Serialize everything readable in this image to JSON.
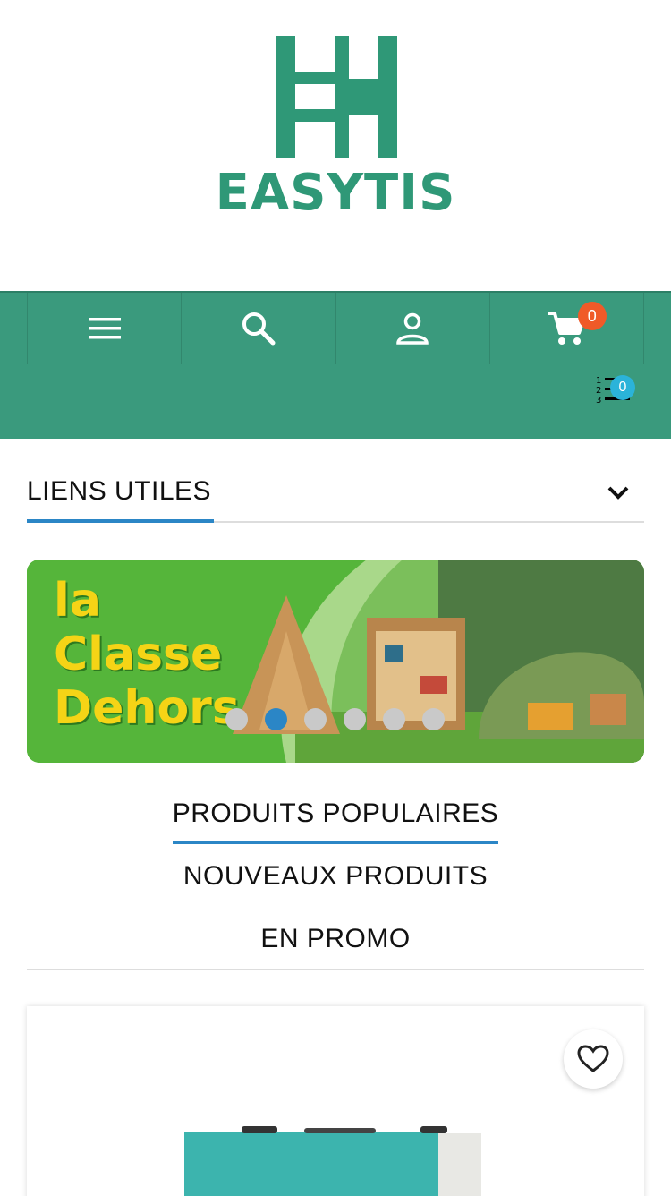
{
  "logo": {
    "text": "EASYTIS",
    "color": "#2f9877"
  },
  "navbar": {
    "background": "#3a9a7d",
    "items": [
      {
        "icon": "menu-icon"
      },
      {
        "icon": "search-icon"
      },
      {
        "icon": "account-icon"
      },
      {
        "icon": "cart-icon",
        "badge": "0"
      }
    ],
    "compare": {
      "icon": "compare-list-icon",
      "badge": "0"
    }
  },
  "useful_links": {
    "title": "LIENS UTILES",
    "icon": "chevron-down-icon"
  },
  "banner": {
    "text_line1": "la",
    "text_line2": "Classe",
    "text_line3": "Dehors",
    "slides": 6,
    "active_slide": 2
  },
  "tabs": [
    {
      "label": "PRODUITS POPULAIRES",
      "active": true
    },
    {
      "label": "NOUVEAUX PRODUITS",
      "active": false
    },
    {
      "label": "EN PROMO",
      "active": false
    }
  ],
  "product": {
    "icon": "heart-icon"
  },
  "colors": {
    "accent": "#2b86c6",
    "badge_cart": "#f05a28",
    "badge_compare": "#2bb3d9"
  }
}
